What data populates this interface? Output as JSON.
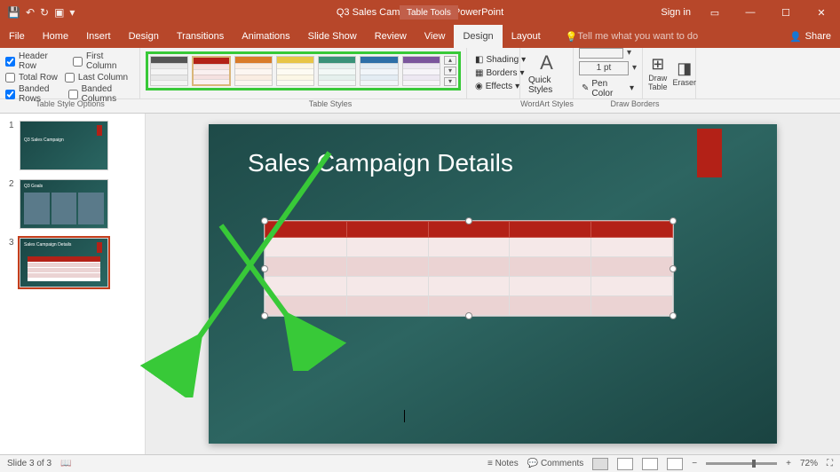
{
  "titlebar": {
    "filename": "Q3 Sales Campaign.pptx  -  PowerPoint",
    "tools_context": "Table Tools",
    "signin": "Sign in"
  },
  "tabs": {
    "file": "File",
    "home": "Home",
    "insert": "Insert",
    "design": "Design",
    "transitions": "Transitions",
    "animations": "Animations",
    "slideshow": "Slide Show",
    "review": "Review",
    "view": "View",
    "ctx_design": "Design",
    "ctx_layout": "Layout",
    "tellme": "Tell me what you want to do",
    "share": "Share"
  },
  "options": {
    "header_row": "Header Row",
    "total_row": "Total Row",
    "banded_rows": "Banded Rows",
    "first_column": "First Column",
    "last_column": "Last Column",
    "banded_columns": "Banded Columns"
  },
  "ribbon_groups": {
    "opts": "Table Style Options",
    "styles": "Table Styles",
    "wordart": "WordArt Styles",
    "drawborders": "Draw Borders"
  },
  "ribbon_buttons": {
    "shading": "Shading",
    "borders": "Borders",
    "effects": "Effects",
    "quick_styles": "Quick Styles",
    "pen_weight": "1 pt",
    "pen_color": "Pen Color",
    "draw_table": "Draw Table",
    "eraser": "Eraser"
  },
  "style_colors": [
    "#555555",
    "#B32117",
    "#D97B29",
    "#E8C547",
    "#3A9278",
    "#2E6FA7",
    "#7B559C"
  ],
  "thumbs": [
    {
      "num": "1",
      "title": "Q3 Sales Campaign"
    },
    {
      "num": "2",
      "title": "Q3 Goals"
    },
    {
      "num": "3",
      "title": "Sales Campaign Details"
    }
  ],
  "slide": {
    "title": "Sales Campaign Details",
    "table": {
      "cols": 5,
      "rows": 5
    }
  },
  "status": {
    "slide_of": "Slide 3 of 3",
    "notes": "Notes",
    "comments": "Comments",
    "zoom": "72%"
  }
}
